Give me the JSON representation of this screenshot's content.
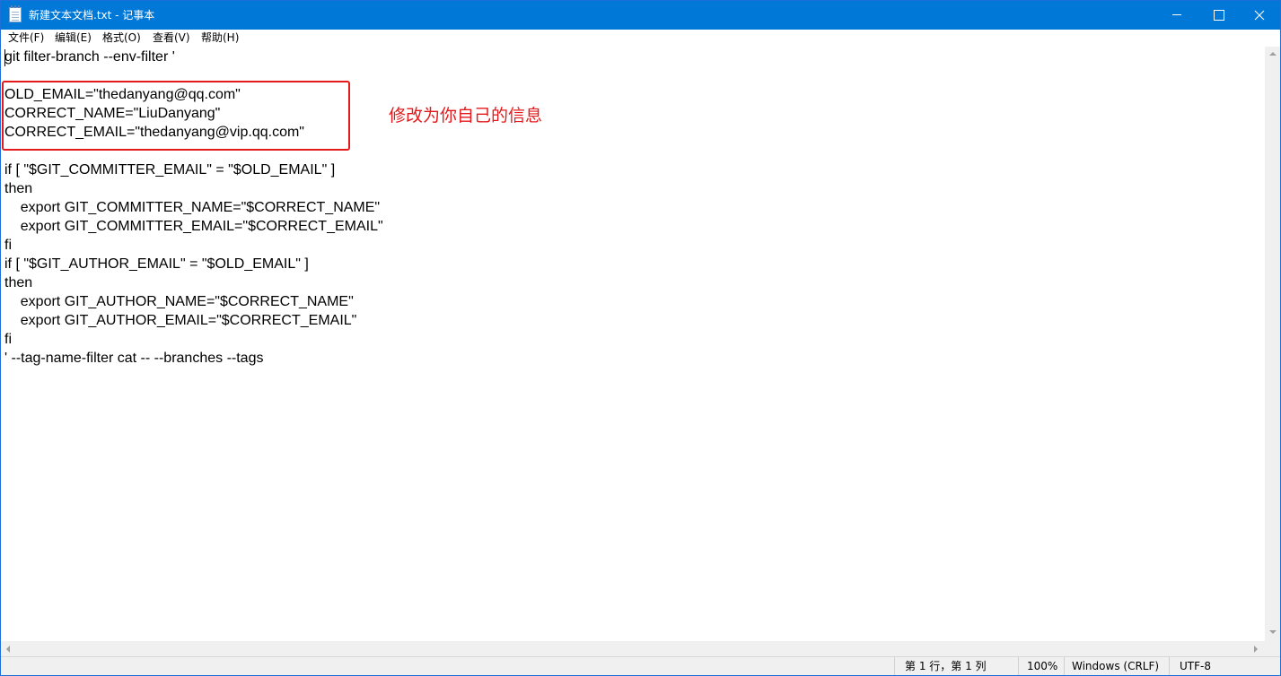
{
  "window": {
    "title": "新建文本文档.txt - 记事本",
    "accent_color": "#0078d7",
    "icons": {
      "app": "notepad-icon",
      "minimize": "minimize-icon",
      "maximize": "maximize-icon",
      "close": "close-icon"
    }
  },
  "menu": {
    "file": "文件(F)",
    "edit": "编辑(E)",
    "format": "格式(O)",
    "view": "查看(V)",
    "help": "帮助(H)"
  },
  "editor": {
    "lines": [
      "git filter-branch --env-filter '",
      "",
      "OLD_EMAIL=\"thedanyang@qq.com\"",
      "CORRECT_NAME=\"LiuDanyang\"",
      "CORRECT_EMAIL=\"thedanyang@vip.qq.com\"",
      "",
      "if [ \"$GIT_COMMITTER_EMAIL\" = \"$OLD_EMAIL\" ]",
      "then",
      "    export GIT_COMMITTER_NAME=\"$CORRECT_NAME\"",
      "    export GIT_COMMITTER_EMAIL=\"$CORRECT_EMAIL\"",
      "fi",
      "if [ \"$GIT_AUTHOR_EMAIL\" = \"$OLD_EMAIL\" ]",
      "then",
      "    export GIT_AUTHOR_NAME=\"$CORRECT_NAME\"",
      "    export GIT_AUTHOR_EMAIL=\"$CORRECT_EMAIL\"",
      "fi",
      "' --tag-name-filter cat -- --branches --tags"
    ],
    "annotation_text": "修改为你自己的信息",
    "annotation_color": "#e4191b"
  },
  "status": {
    "position": "第 1 行，第 1 列",
    "zoom": "100%",
    "line_ending": "Windows (CRLF)",
    "encoding": "UTF-8"
  }
}
